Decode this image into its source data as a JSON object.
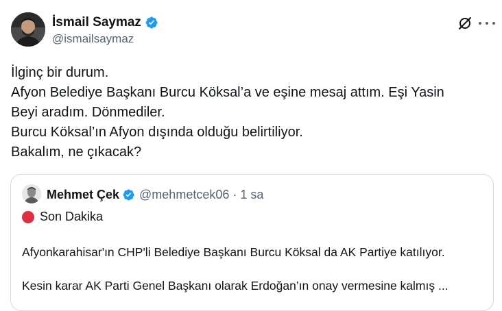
{
  "author": {
    "name": "İsmail Saymaz",
    "handle": "@ismailsaymaz"
  },
  "tweet": {
    "lines": [
      "İlginç bir durum.",
      "Afyon Belediye Başkanı Burcu Köksal’a ve eşine mesaj attım. Eşi Yasin",
      "Beyi aradım. Dönmediler.",
      "Burcu Köksal’ın Afyon dışında olduğu belirtiliyor.",
      "Bakalım, ne çıkacak?"
    ]
  },
  "quote": {
    "name": "Mehmet Çek",
    "handle": "@mehmetcek06",
    "separator": "·",
    "time": "1 sa",
    "headline": "Son Dakika",
    "paragraph1": "Afyonkarahisar'ın CHP'li Belediye Başkanı Burcu Köksal da AK Partiye katılıyor.",
    "paragraph2": "Kesin karar AK Parti Genel Başkanı olarak Erdoğan’ın onay vermesine kalmış ..."
  },
  "icons": {
    "verified": "verified-badge-icon",
    "grok": "grok-icon",
    "more": "more-options-icon",
    "red_circle": "red-circle-emoji"
  },
  "colors": {
    "text": "#0f1419",
    "secondary": "#536471",
    "verified": "#1d9bf0",
    "border": "#cfd9de",
    "red": "#dd2e44"
  }
}
